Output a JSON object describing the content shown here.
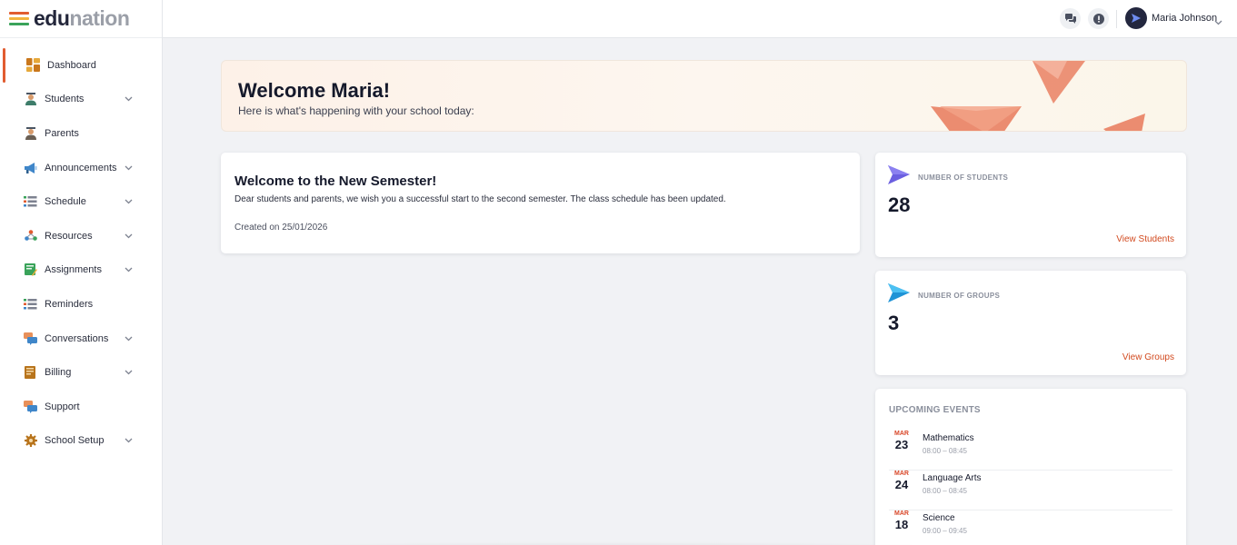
{
  "logo": {
    "part1": "edu",
    "part2": "nation",
    "stripes": [
      "#e15c30",
      "#f2b33d",
      "#3aa35a"
    ]
  },
  "sidebar": {
    "items": [
      {
        "label": "Dashboard",
        "icon": "dashboard-icon",
        "chevron": false,
        "active": true
      },
      {
        "label": "Students",
        "icon": "students-icon",
        "chevron": true
      },
      {
        "label": "Parents",
        "icon": "parents-icon",
        "chevron": false
      },
      {
        "label": "Announcements",
        "icon": "megaphone-icon",
        "chevron": true
      },
      {
        "label": "Schedule",
        "icon": "schedule-icon",
        "chevron": true
      },
      {
        "label": "Resources",
        "icon": "resources-icon",
        "chevron": true
      },
      {
        "label": "Assignments",
        "icon": "assignments-icon",
        "chevron": true
      },
      {
        "label": "Reminders",
        "icon": "reminders-icon",
        "chevron": false
      },
      {
        "label": "Conversations",
        "icon": "conversations-icon",
        "chevron": true
      },
      {
        "label": "Billing",
        "icon": "billing-icon",
        "chevron": true
      },
      {
        "label": "Support",
        "icon": "support-icon",
        "chevron": false
      },
      {
        "label": "School Setup",
        "icon": "gear-icon",
        "chevron": true
      }
    ]
  },
  "header": {
    "user_name": "Maria Johnson"
  },
  "banner": {
    "title": "Welcome Maria!",
    "subtitle": "Here is what's happening with your school today:"
  },
  "announcement": {
    "title": "Welcome to the New Semester!",
    "body": "Dear students and parents, we wish you a successful start to the second semester. The class schedule has been updated.",
    "created": "Created on 25/01/2026"
  },
  "stats": {
    "students": {
      "label": "NUMBER OF STUDENTS",
      "value": "28",
      "link": "View Students",
      "color": "#6b5fe0"
    },
    "groups": {
      "label": "NUMBER OF GROUPS",
      "value": "3",
      "link": "View Groups",
      "color": "#2aa7e6"
    }
  },
  "events": {
    "title": "UPCOMING EVENTS",
    "items": [
      {
        "month": "MAR",
        "day": "23",
        "name": "Mathematics",
        "time": "08:00 – 08:45"
      },
      {
        "month": "MAR",
        "day": "24",
        "name": "Language Arts",
        "time": "08:00 – 08:45"
      },
      {
        "month": "MAR",
        "day": "18",
        "name": "Science",
        "time": "09:00 – 09:45"
      }
    ]
  },
  "colors": {
    "accent": "#e15c30",
    "link": "#d24a1f"
  }
}
